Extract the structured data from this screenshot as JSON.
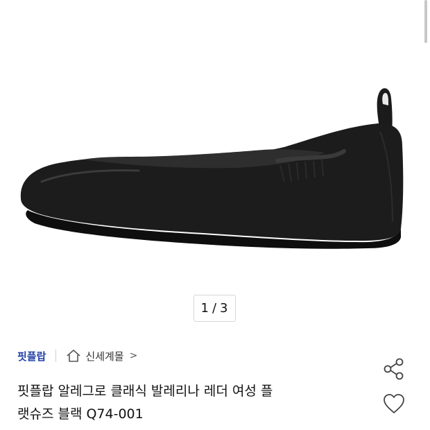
{
  "gallery": {
    "current": "1",
    "separator": "/",
    "total": "3"
  },
  "product": {
    "brand": "핏플랍",
    "store": "신세계몰",
    "store_chevron": ">",
    "title_line1": "핏플랍 알레그로 클래식 발레리나 레더 여성 플",
    "title_line2": "랫슈즈 블랙 Q74-001"
  },
  "colors": {
    "brand": "#1f3fa6",
    "text": "#111111",
    "shoe": "#1a1a1a"
  },
  "icons": {
    "store": "home-icon",
    "share": "share-icon",
    "like": "heart-icon"
  }
}
